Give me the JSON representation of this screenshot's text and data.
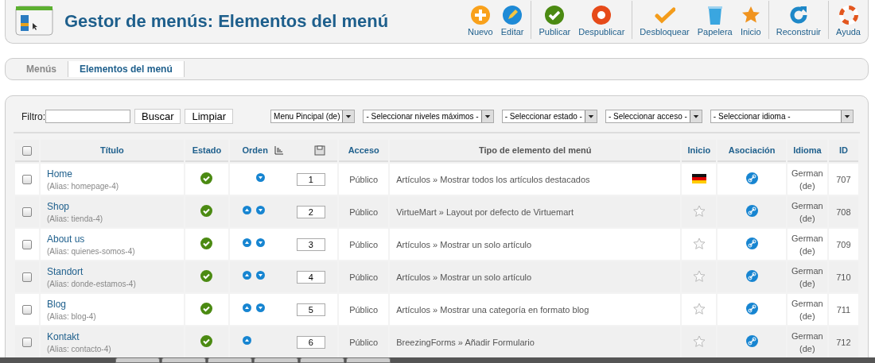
{
  "header": {
    "title": "Gestor de menús: Elementos del menú"
  },
  "toolbar": [
    [
      {
        "kind": "new",
        "label": "Nuevo"
      },
      {
        "kind": "edit",
        "label": "Editar"
      }
    ],
    [
      {
        "kind": "publish",
        "label": "Publicar"
      },
      {
        "kind": "unpublish",
        "label": "Despublicar"
      }
    ],
    [
      {
        "kind": "checkin",
        "label": "Desbloquear"
      },
      {
        "kind": "trash",
        "label": "Papelera"
      },
      {
        "kind": "home",
        "label": "Inicio"
      }
    ],
    [
      {
        "kind": "rebuild",
        "label": "Reconstruir"
      }
    ],
    [
      {
        "kind": "help",
        "label": "Ayuda"
      }
    ]
  ],
  "submenu": [
    {
      "label": "Menús",
      "selected": false
    },
    {
      "label": "Elementos del menú",
      "selected": true
    }
  ],
  "filter": {
    "label": "Filtro:",
    "search_button": "Buscar",
    "clear_button": "Limpiar",
    "selects": [
      {
        "value": "Menu Pincipal (de)"
      },
      {
        "value": "- Seleccionar niveles máximos -"
      },
      {
        "value": "- Seleccionar estado -"
      },
      {
        "value": "- Seleccionar acceso -"
      },
      {
        "value": "- Seleccionar idioma -"
      }
    ]
  },
  "table": {
    "select_all_checked": false,
    "columns": [
      "Título",
      "Estado",
      "Orden",
      "Acceso",
      "Tipo de elemento del menú",
      "Inicio",
      "Asociación",
      "Idioma",
      "ID"
    ],
    "rows": [
      {
        "title": "Home",
        "alias": "(Alias: homepage-4)",
        "published": true,
        "up": false,
        "down": true,
        "order": "1",
        "access": "Público",
        "type": "Artículos » Mostrar todos los artículos destacados",
        "home": true,
        "language": "German (de)",
        "id": "707",
        "checked": false
      },
      {
        "title": "Shop",
        "alias": "(Alias: tienda-4)",
        "published": true,
        "up": true,
        "down": true,
        "order": "2",
        "access": "Público",
        "type": "VirtueMart » Layout por defecto de Virtuemart",
        "home": false,
        "language": "German (de)",
        "id": "708",
        "checked": false
      },
      {
        "title": "About us",
        "alias": "(Alias: quienes-somos-4)",
        "published": true,
        "up": true,
        "down": true,
        "order": "3",
        "access": "Público",
        "type": "Artículos » Mostrar un solo artículo",
        "home": false,
        "language": "German (de)",
        "id": "709",
        "checked": false
      },
      {
        "title": "Standort",
        "alias": "(Alias: donde-estamos-4)",
        "published": true,
        "up": true,
        "down": true,
        "order": "4",
        "access": "Público",
        "type": "Artículos » Mostrar un solo artículo",
        "home": false,
        "language": "German (de)",
        "id": "710",
        "checked": false
      },
      {
        "title": "Blog",
        "alias": "(Alias: blog-4)",
        "published": true,
        "up": true,
        "down": true,
        "order": "5",
        "access": "Público",
        "type": "Artículos » Mostrar una categoría en formato blog",
        "home": false,
        "language": "German (de)",
        "id": "711",
        "checked": false
      },
      {
        "title": "Kontakt",
        "alias": "(Alias: contacto-4)",
        "published": true,
        "up": true,
        "down": false,
        "order": "6",
        "access": "Público",
        "type": "BreezingForms » Añadir Formulario",
        "home": false,
        "language": "German (de)",
        "id": "712",
        "checked": false
      }
    ]
  }
}
